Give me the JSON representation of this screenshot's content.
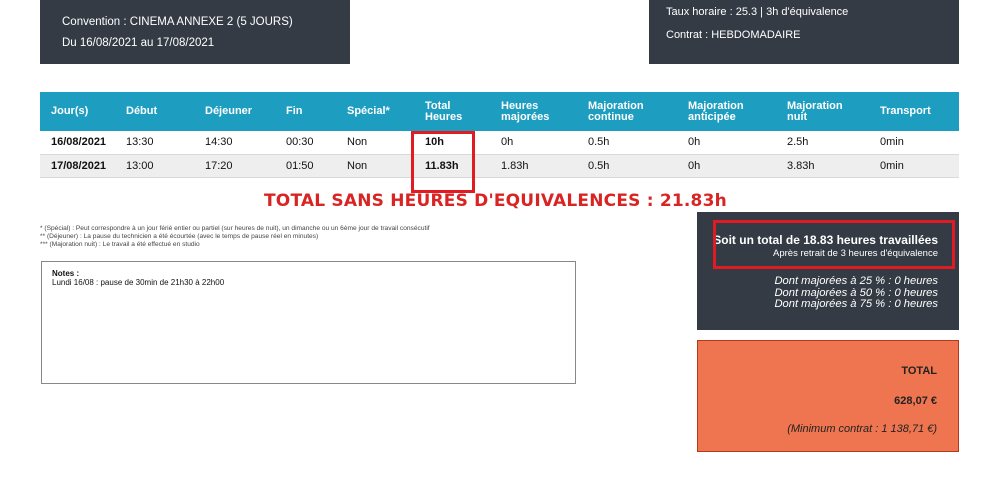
{
  "header": {
    "convention": "Convention : CINEMA ANNEXE 2 (5 JOURS)",
    "period": "Du 16/08/2021 au 17/08/2021",
    "rate": "Taux horaire : 25.3 | 3h d'équivalence",
    "contract": "Contrat : HEBDOMADAIRE"
  },
  "table": {
    "columns": [
      "Jour(s)",
      "Début",
      "Déjeuner",
      "Fin",
      "Spécial*",
      "Total\nHeures",
      "Heures\nmajorées",
      "Majoration\ncontinue",
      "Majoration\nanticipée",
      "Majoration\nnuit",
      "Transport"
    ],
    "rows": [
      [
        "16/08/2021",
        "13:30",
        "14:30",
        "00:30",
        "Non",
        "10h",
        "0h",
        "0.5h",
        "0h",
        "2.5h",
        "0min"
      ],
      [
        "17/08/2021",
        "13:00",
        "17:20",
        "01:50",
        "Non",
        "11.83h",
        "1.83h",
        "0.5h",
        "0h",
        "3.83h",
        "0min"
      ]
    ]
  },
  "total_line": "TOTAL SANS HEURES D'EQUIVALENCES : 21.83h",
  "footnotes": [
    "* (Spécial) : Peut correspondre à un jour férié entier ou partiel (sur heures de nuit), un dimanche ou un 6ème jour de travail consécutif",
    "** (Déjeuner) : La pause du technicien a été écourtée (avec le temps de pause réel en minutes)",
    "*** (Majoration nuit) : Le travail a été effectué en studio"
  ],
  "notes": {
    "title": "Notes :",
    "text": "Lundi 16/08 : pause de 30min de 21h30 à 22h00"
  },
  "summary": {
    "main": "Soit un total de 18.83 heures travaillées",
    "sub": "Après retrait de 3 heures d'équivalence",
    "items": [
      "Dont majorées à 25 % : 0 heures",
      "Dont majorées à 50 % : 0 heures",
      "Dont majorées à 75 % : 0 heures"
    ]
  },
  "total_box": {
    "label": "TOTAL",
    "amount": "628,07 €",
    "minimum": "(Minimum contrat : 1 138,71 €)"
  },
  "colors": {
    "dark_panel": "#343b44",
    "table_header": "#1d9dc0",
    "highlight": "#e01b24",
    "total_box": "#ee7550"
  }
}
